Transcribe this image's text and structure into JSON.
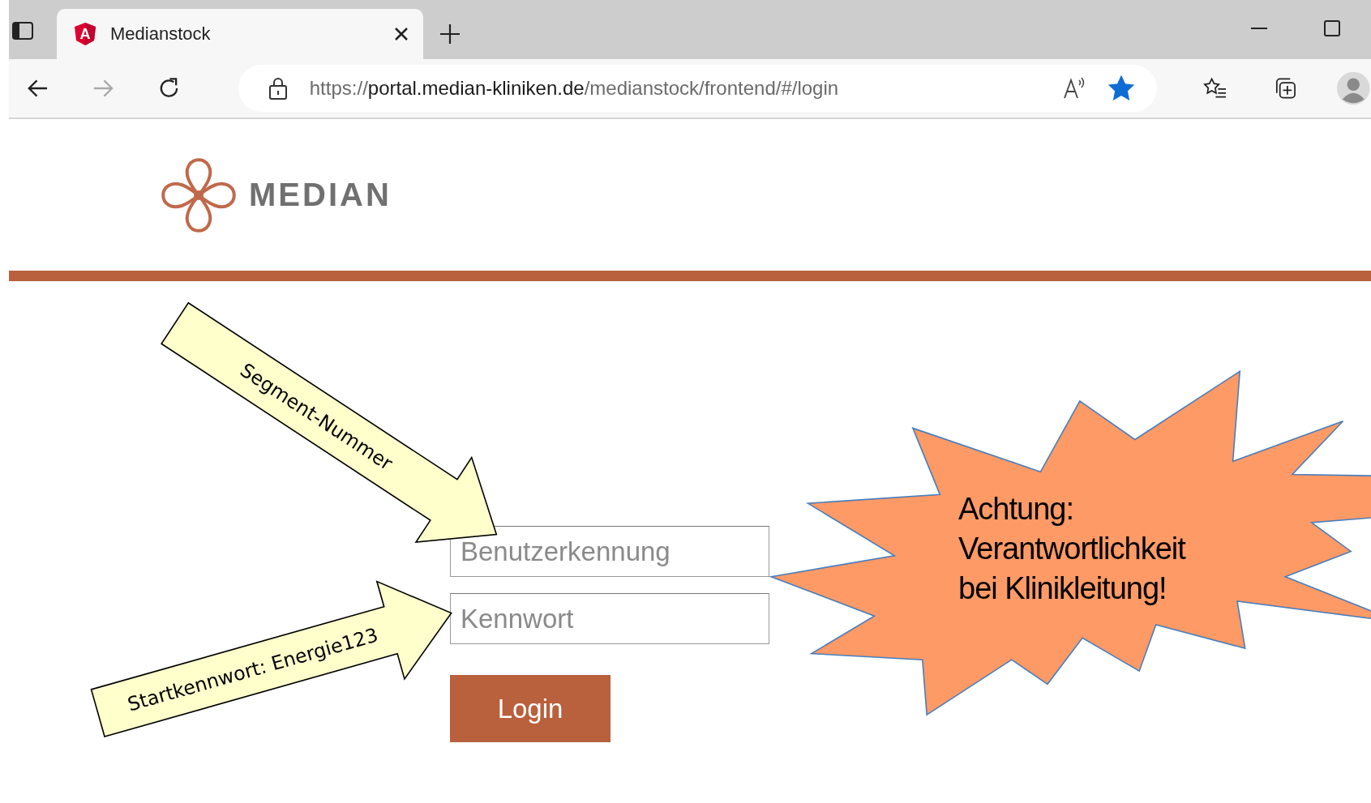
{
  "browser": {
    "tab": {
      "icon_letter": "A",
      "title": "Medianstock",
      "selected": true
    },
    "address_bar": {
      "scheme": "https://",
      "host": "portal.median-kliniken.de",
      "path": "/medianstock/frontend/#/login"
    },
    "favorite": {
      "on": true
    }
  },
  "header": {
    "logo_text": "MEDIAN"
  },
  "login_form": {
    "username": {
      "placeholder": "Benutzerkennung"
    },
    "password": {
      "placeholder": "Kennwort"
    },
    "button": "Login"
  },
  "annotations": [
    {
      "kind": "arrow",
      "label": "Segment-Nummer"
    },
    {
      "kind": "arrow",
      "label": "Startkennwort: Energie123"
    },
    {
      "kind": "starburst",
      "label": "Achtung: Verantwortlichkeit bei Klinikleitung!"
    }
  ]
}
